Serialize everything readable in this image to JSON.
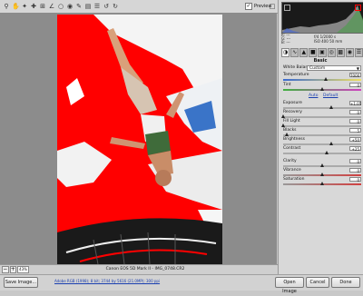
{
  "toolbar": {
    "tools": [
      "zoom-icon",
      "hand-icon",
      "white-balance-icon",
      "color-sampler-icon",
      "crop-icon",
      "straighten-icon",
      "retouch-icon",
      "red-eye-icon",
      "adjustment-brush-icon",
      "graduated-filter-icon",
      "preferences-icon",
      "rotate-left-icon",
      "rotate-right-icon"
    ],
    "preview_label": "Preview",
    "preview_checked": true
  },
  "histogram": {
    "r_label": "R:",
    "g_label": "G:",
    "b_label": "B:",
    "r": "---",
    "g": "---",
    "b": "---",
    "aperture": "f/4",
    "shutter": "1/2000 s",
    "iso": "ISO 400",
    "focal": "50 mm"
  },
  "panel": {
    "section_title": "Basic",
    "white_balance_label": "White Balance:",
    "white_balance_value": "Custom",
    "auto_label": "Auto",
    "default_label": "Default",
    "sliders": [
      {
        "name": "temperature",
        "label": "Temperature",
        "value": "7000",
        "level": 0.55
      },
      {
        "name": "tint",
        "label": "Tint",
        "value": "0",
        "level": 0.5
      },
      {
        "name": "exposure",
        "label": "Exposure",
        "value": "+1.05",
        "level": 0.62
      },
      {
        "name": "recovery",
        "label": "Recovery",
        "value": "0",
        "level": 0.0
      },
      {
        "name": "fill-light",
        "label": "Fill Light",
        "value": "0",
        "level": 0.0
      },
      {
        "name": "blacks",
        "label": "Blacks",
        "value": "5",
        "level": 0.05
      },
      {
        "name": "brightness",
        "label": "Brightness",
        "value": "+50",
        "level": 0.62
      },
      {
        "name": "contrast",
        "label": "Contrast",
        "value": "+25",
        "level": 0.56
      },
      {
        "name": "clarity",
        "label": "Clarity",
        "value": "0",
        "level": 0.5
      },
      {
        "name": "vibrance",
        "label": "Vibrance",
        "value": "0",
        "level": 0.5
      },
      {
        "name": "saturation",
        "label": "Saturation",
        "value": "0",
        "level": 0.5
      }
    ]
  },
  "status": {
    "zoom": "43%",
    "filename": "Canon EOS 5D Mark II - IMG_0748.CR2"
  },
  "bottom": {
    "save_label": "Save Image...",
    "workflow_link": "Adobe RGB (1998); 8 bit; 3744 by 5616 (21.0MP); 300 ppi",
    "open_label": "Open Image",
    "cancel_label": "Cancel",
    "done_label": "Done"
  },
  "colors": {
    "clip_warning": "#ff0000",
    "accent": "#1a3fb0"
  }
}
